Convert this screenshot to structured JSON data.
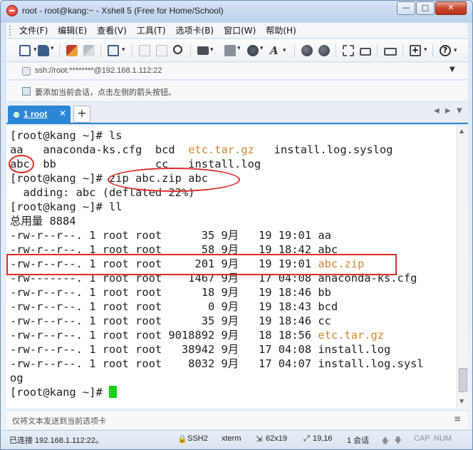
{
  "window": {
    "title": "root - root@kang:~ - Xshell 5 (Free for Home/School)",
    "controls": {
      "minimize": "—",
      "maximize": "□",
      "close": "✕"
    }
  },
  "menu": [
    "文件(F)",
    "编辑(E)",
    "查看(V)",
    "工具(T)",
    "选项卡(B)",
    "窗口(W)",
    "帮助(H)"
  ],
  "address": {
    "value": "ssh://root:********@192.168.1.112:22"
  },
  "hint": {
    "text": "要添加当前会话，点击左侧的箭头按钮。"
  },
  "tabs": [
    {
      "label": "1 root",
      "close": "✕"
    }
  ],
  "tab_add": "+",
  "terminal": {
    "lines": [
      {
        "text": "[root@kang ~]# ls"
      },
      {
        "segments": [
          {
            "t": "aa   anaconda-ks.cfg  bcd  "
          },
          {
            "t": "etc.tar.gz",
            "c": "orange"
          },
          {
            "t": "   install.log.syslog"
          }
        ]
      },
      {
        "text": "abc  bb               cc   install.log"
      },
      {
        "text": "[root@kang ~]# zip abc.zip abc"
      },
      {
        "text": "  adding: abc (deflated 22%)"
      },
      {
        "text": "[root@kang ~]# ll"
      },
      {
        "text": "总用量 8884"
      },
      {
        "text": "-rw-r--r--. 1 root root      35 9月   19 19:01 aa"
      },
      {
        "text": "-rw-r--r--. 1 root root      58 9月   19 18:42 abc"
      },
      {
        "segments": [
          {
            "t": "-rw-r--r--. 1 root root     201 9月   19 19:01 "
          },
          {
            "t": "abc.zip",
            "c": "orange"
          }
        ]
      },
      {
        "text": "-rw-------. 1 root root    1467 9月   17 04:08 anaconda-ks.cfg"
      },
      {
        "text": "-rw-r--r--. 1 root root      18 9月   19 18:46 bb"
      },
      {
        "text": "-rw-r--r--. 1 root root       0 9月   19 18:43 bcd"
      },
      {
        "text": "-rw-r--r--. 1 root root      35 9月   19 18:46 cc"
      },
      {
        "segments": [
          {
            "t": "-rw-r--r--. 1 root root 9018892 9月   18 18:56 "
          },
          {
            "t": "etc.tar.gz",
            "c": "orange"
          }
        ]
      },
      {
        "text": "-rw-r--r--. 1 root root   38942 9月   17 04:08 install.log"
      },
      {
        "text": "-rw-r--r--. 1 root root    8032 9月   17 04:07 install.log.sysl"
      },
      {
        "text": "og"
      },
      {
        "text": "[root@kang ~]# ",
        "cursor": true
      }
    ]
  },
  "sendbar": {
    "placeholder": "仅将文本发送到当前选项卡",
    "menu_icon": "≡"
  },
  "status": {
    "connection": "已连接 192.168.1.112:22。",
    "protocol": "SSH2",
    "terminal_type": "xterm",
    "size": "62x19",
    "cursor_pos": "19,16",
    "sessions": "1 会话",
    "caps": "CAP",
    "num": "NUM"
  },
  "colors": {
    "accent": "#2b86d6",
    "highlight_file": "#d4862c",
    "annotation": "#e02a2a",
    "cursor": "#12d412"
  },
  "toolbar_icons": [
    "new-session-icon",
    "open-folder-icon",
    "disconnect-icon",
    "reconnect-icon",
    "properties-icon",
    "copy-icon",
    "paste-icon",
    "find-icon",
    "print-icon",
    "transfer-icon",
    "globe-icon",
    "font-icon",
    "xftp-icon",
    "xmanager-icon",
    "fullscreen-icon",
    "lock-icon",
    "keyboard-icon",
    "new-tab-icon",
    "help-icon"
  ]
}
